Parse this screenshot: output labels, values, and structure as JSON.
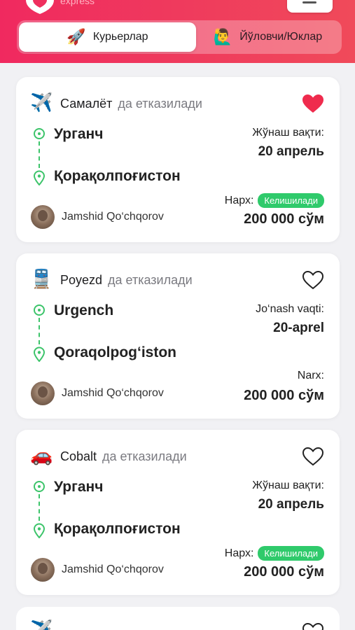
{
  "header": {
    "logo_text": "express",
    "colors": {
      "brand": "#ef2f5e",
      "accent_green": "#2fca6b",
      "heart_active": "#ef2b4d"
    }
  },
  "tabs": [
    {
      "emoji": "🚀",
      "label": "Курьерлар",
      "active": true
    },
    {
      "emoji": "🙋‍♂️",
      "label": "Йўловчи/Юклар",
      "active": false
    }
  ],
  "cards": [
    {
      "vehicle_emoji": "✈️",
      "vehicle": "Самалёт",
      "vehicle_suffix": "да етказилади",
      "from": "Урганч",
      "to": "Қорақолпоғистон",
      "date_label": "Жўнаш вақти:",
      "date": "20 апрель",
      "price_label": "Нарх:",
      "badge": "Келишилади",
      "price": "200 000 сўм",
      "user": "Jamshid Qo‘chqorov",
      "favorite": true
    },
    {
      "vehicle_emoji": "🚆",
      "vehicle": "Poyezd",
      "vehicle_suffix": "да етказилади",
      "from": "Urgench",
      "to": "Qoraqolpog‘iston",
      "date_label": "Jo‘nash vaqti:",
      "date": "20-aprel",
      "price_label": "Narx:",
      "badge": "",
      "price": "200 000 сўм",
      "user": "Jamshid Qo‘chqorov",
      "favorite": false
    },
    {
      "vehicle_emoji": "🚗",
      "vehicle": "Cobalt",
      "vehicle_suffix": "да етказилади",
      "from": "Урганч",
      "to": "Қорақолпоғистон",
      "date_label": "Жўнаш вақти:",
      "date": "20 апрель",
      "price_label": "Нарх:",
      "badge": "Келишилади",
      "price": "200 000 сўм",
      "user": "Jamshid Qo‘chqorov",
      "favorite": false
    },
    {
      "vehicle_emoji": "✈️",
      "favorite": false
    }
  ],
  "icons": [
    "logo-shield-icon",
    "menu-icon",
    "rocket-icon",
    "person-raising-hand-icon",
    "airplane-icon",
    "train-icon",
    "car-icon",
    "heart-icon",
    "start-point-icon",
    "location-pin-icon"
  ]
}
